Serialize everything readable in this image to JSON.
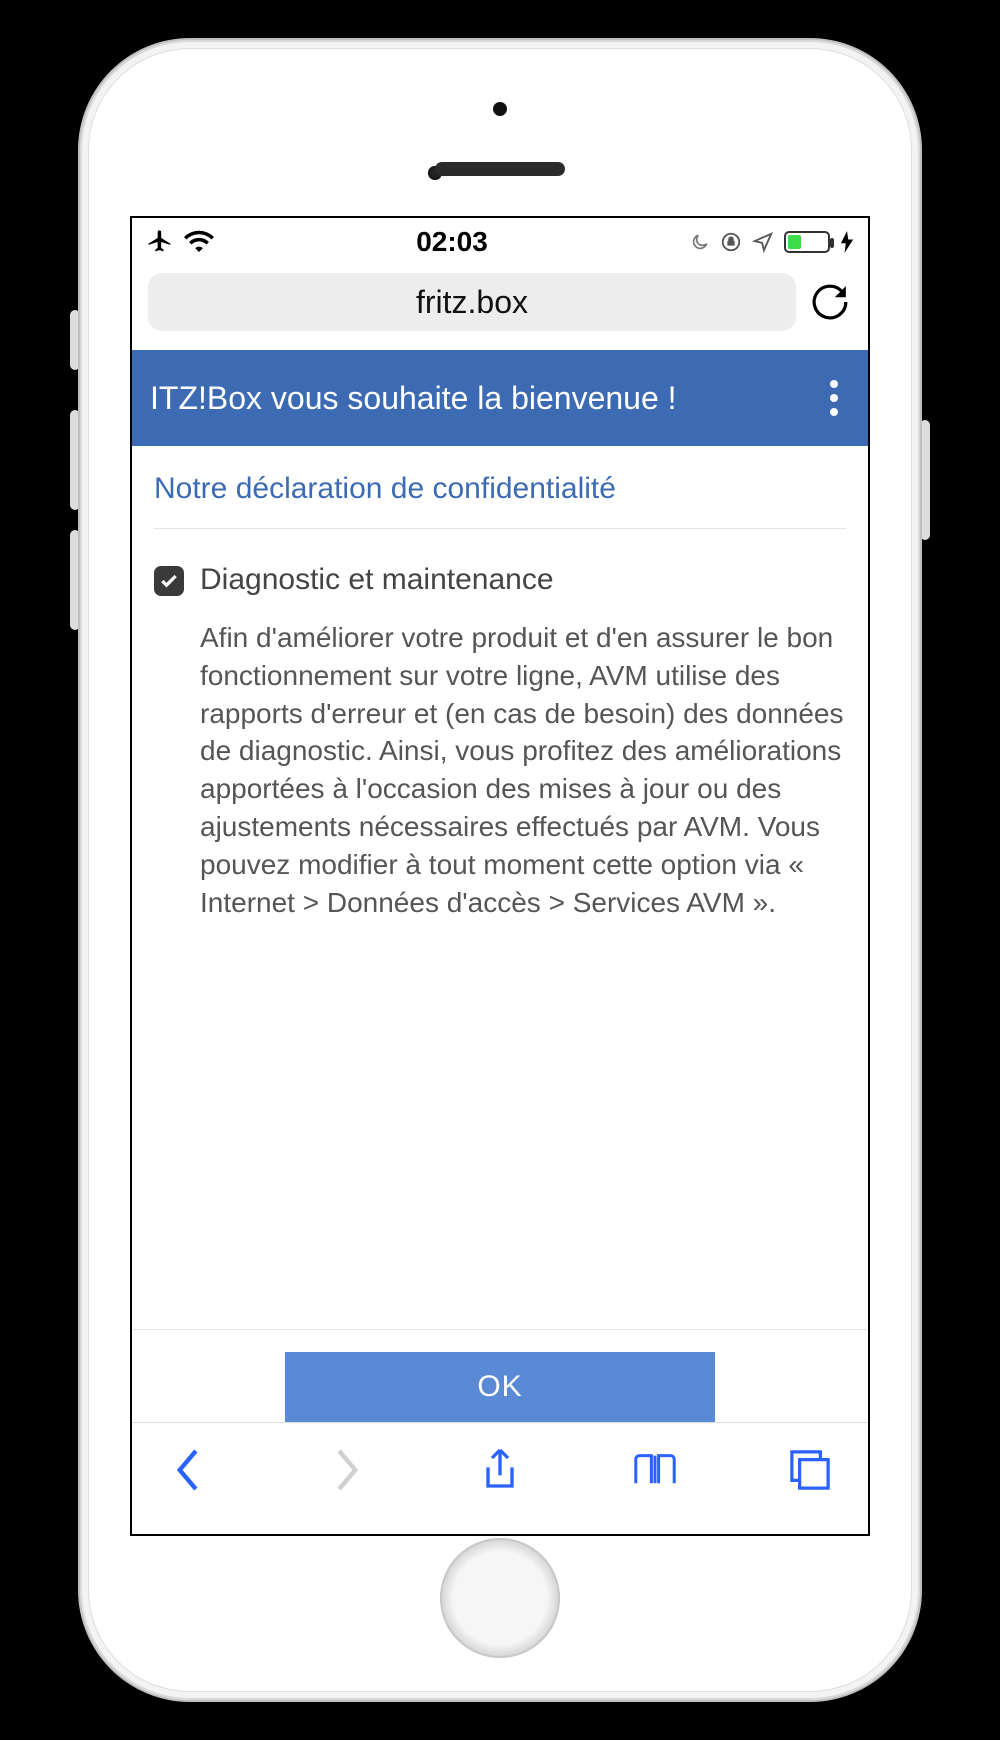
{
  "status_bar": {
    "time": "02:03"
  },
  "browser": {
    "url": "fritz.box"
  },
  "page": {
    "header_title": "ITZ!Box vous souhaite la bienvenue !",
    "privacy_link": "Notre déclaration de confidentialité",
    "checkbox": {
      "checked": true,
      "label": "Diagnostic et maintenance",
      "description": "Afin d'améliorer votre produit et d'en assurer le bon fonctionnement sur votre ligne, AVM utilise des rapports d'erreur et (en cas de besoin) des données de diagnostic. Ainsi, vous profitez des améliorations apportées à l'occasion des mises à jour ou des ajustements nécessaires effectués par AVM. Vous pouvez modifier à tout moment cette option via « Internet > Données d'accès > Services AVM »."
    },
    "ok_button": "OK"
  }
}
